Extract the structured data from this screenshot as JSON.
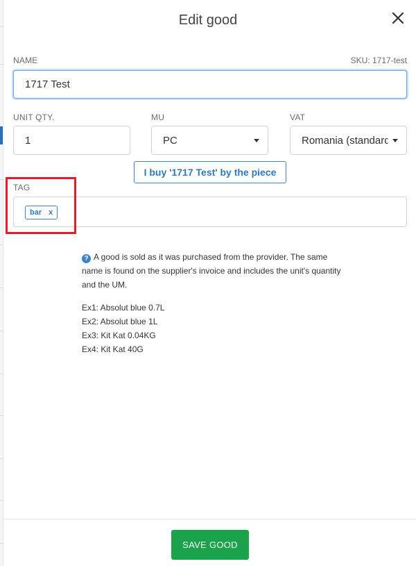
{
  "dialog": {
    "title": "Edit good"
  },
  "name_field": {
    "label": "NAME",
    "sku": "SKU: 1717-test",
    "value": "1717 Test"
  },
  "unit_qty": {
    "label": "UNIT QTY.",
    "value": "1"
  },
  "mu": {
    "label": "MU",
    "selected": "PC"
  },
  "vat": {
    "label": "VAT",
    "selected": "Romania (standard)"
  },
  "buy_button": {
    "label": "I buy '1717 Test' by the piece"
  },
  "tag": {
    "label": "TAG",
    "chips": [
      {
        "label": "bar",
        "remove": "x"
      }
    ]
  },
  "help": {
    "text": "A good is sold as it was purchased from the provider. The same name is found on the supplier's invoice and includes the unit's quantity and the UM.",
    "examples": [
      "Ex1: Absolut blue 0.7L",
      "Ex2: Absolut blue 1L",
      "Ex3: Kit Kat 0.04KG",
      "Ex4: Kit Kat 40G"
    ]
  },
  "save_button": {
    "label": "SAVE GOOD"
  },
  "colors": {
    "accent": "#2e79bd",
    "save": "#1aa34a",
    "highlight": "#e01f2a"
  },
  "icons": {
    "close": "close-icon",
    "help": "question-icon",
    "caret": "chevron-down-icon"
  }
}
